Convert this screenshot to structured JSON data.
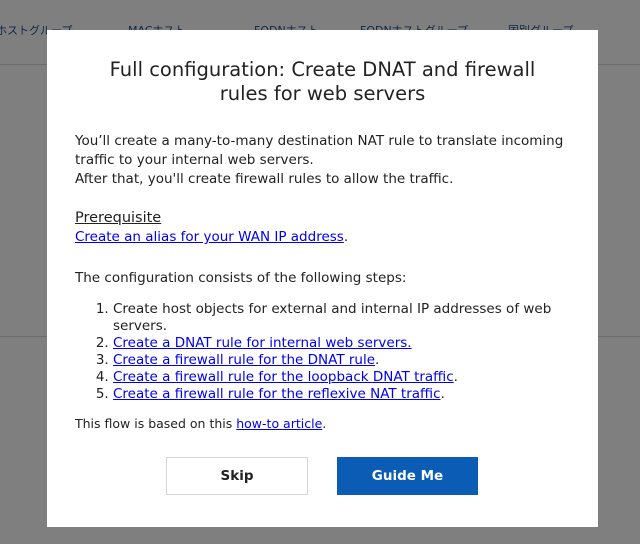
{
  "background": {
    "tabs": [
      "ホストグループ",
      "MACホスト",
      "FQDNホスト",
      "FQDNホストグループ",
      "国別グループ"
    ]
  },
  "modal": {
    "title": "Full configuration: Create DNAT and firewall rules for web servers",
    "intro_line1": "You’ll create a many-to-many destination NAT rule to translate incoming traffic to your internal web servers.",
    "intro_line2": "After that, you'll create firewall rules to allow the traffic.",
    "prerequisite_heading": "Prerequisite",
    "prerequisite_link": "Create an alias for your WAN IP address",
    "prerequisite_suffix": ".",
    "steps_intro": "The configuration consists of the following steps:",
    "steps": [
      {
        "text": "Create host objects for external and internal IP addresses of web servers.",
        "link": false,
        "suffix": ""
      },
      {
        "text": "Create a DNAT rule for internal web servers.",
        "link": true,
        "suffix": ""
      },
      {
        "text": "Create a firewall rule for the DNAT rule",
        "link": true,
        "suffix": "."
      },
      {
        "text": "Create a firewall rule for the loopback DNAT traffic",
        "link": true,
        "suffix": "."
      },
      {
        "text": "Create a firewall rule for the reflexive NAT traffic",
        "link": true,
        "suffix": "."
      }
    ],
    "footer_prefix": "This flow is based on this ",
    "footer_link": "how-to article",
    "footer_suffix": ".",
    "skip_label": "Skip",
    "guide_label": "Guide Me"
  },
  "colors": {
    "primary_button": "#0b5cb5",
    "link": "#0000ee",
    "overlay": "rgba(0,0,0,0.5)"
  }
}
